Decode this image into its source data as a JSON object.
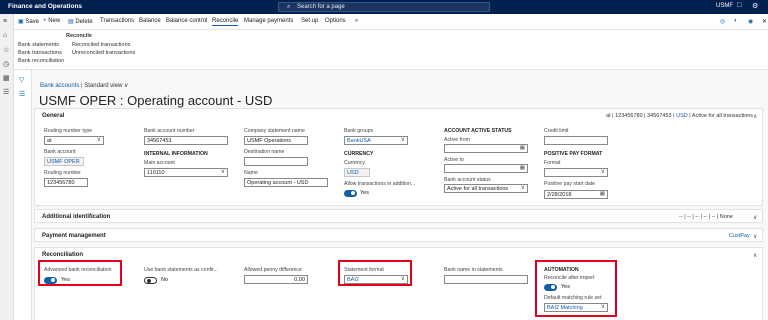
{
  "topbar": {
    "app_title": "Finance and Operations",
    "search_placeholder": "Search for a page",
    "company": "USMF"
  },
  "actions": {
    "save": "Save",
    "new": "New",
    "delete": "Delete",
    "transactions": "Transactions",
    "balance": "Balance",
    "balance_control": "Balance control",
    "reconcile": "Reconcile",
    "manage_payments": "Manage payments",
    "set_up": "Set up",
    "options": "Options"
  },
  "ribbon": {
    "group_title": "Reconcile",
    "items": [
      "Bank statements",
      "Bank transactions",
      "Bank reconciliation",
      "Reconciled transactions",
      "Unreconciled transactions"
    ]
  },
  "breadcrumb": {
    "link": "Bank accounts",
    "separator": "|",
    "view": "Standard view"
  },
  "page_title": "USMF OPER : Operating account - USD",
  "general": {
    "title": "General",
    "summary_prefix": "at",
    "summary_routing": "123456780",
    "summary_account": "34567453",
    "summary_currency": "USD",
    "summary_status": "Active for all transactions",
    "routing_type_label": "Routing number type",
    "routing_type_value": "at",
    "bank_account_label": "Bank account",
    "bank_account_value": "USMF OPER",
    "routing_number_label": "Routing number",
    "routing_number_value": "123456780",
    "bank_acct_num_label": "Bank account number",
    "bank_acct_num_value": "34567453",
    "internal_info": "INTERNAL INFORMATION",
    "main_account_label": "Main account",
    "main_account_value": "110110",
    "company_stmt_label": "Company statement name",
    "company_stmt_value": "USMF Operations",
    "destination_label": "Destination name",
    "destination_value": "",
    "name_label": "Name",
    "name_value": "Operating account - USD",
    "bank_groups_label": "Bank groups",
    "bank_groups_value": "BankUSA",
    "currency_header": "CURRENCY",
    "currency_label": "Currency",
    "currency_value": "USD",
    "allow_tx_label": "Allow transactions in addition...",
    "allow_tx_value": "Yes",
    "active_status_header": "ACCOUNT ACTIVE STATUS",
    "active_from_label": "Active from",
    "active_to_label": "Active to",
    "bank_status_label": "Bank account status",
    "bank_status_value": "Active for all transactions",
    "credit_limit_label": "Credit limit",
    "positive_pay_header": "POSITIVE PAY FORMAT",
    "format_label": "Format",
    "pp_start_label": "Positive pay start date",
    "pp_start_value": "2/28/2018"
  },
  "additional": {
    "title": "Additional identification",
    "summary": "-- | -- | -- | -- | -- | None"
  },
  "payment": {
    "title": "Payment management",
    "summary": "CustPay"
  },
  "reconciliation": {
    "title": "Reconciliation",
    "advanced_label": "Advanced bank reconciliation",
    "advanced_value": "Yes",
    "use_stmt_label": "Use bank statements as confir...",
    "use_stmt_value": "No",
    "penny_label": "Allowed penny difference",
    "penny_value": "0.00",
    "stmt_format_label": "Statement format",
    "stmt_format_value": "BAI2",
    "bank_name_label": "Bank name in statements",
    "bank_name_value": "",
    "automation_header": "AUTOMATION",
    "reconcile_after_label": "Reconcile after import",
    "reconcile_after_value": "Yes",
    "matching_rule_label": "Default matching rule set",
    "matching_rule_value": "BAI2 Matching"
  },
  "colors": {
    "brand": "#002050",
    "accent": "#0f5ea8",
    "highlight": "#e3001b"
  }
}
